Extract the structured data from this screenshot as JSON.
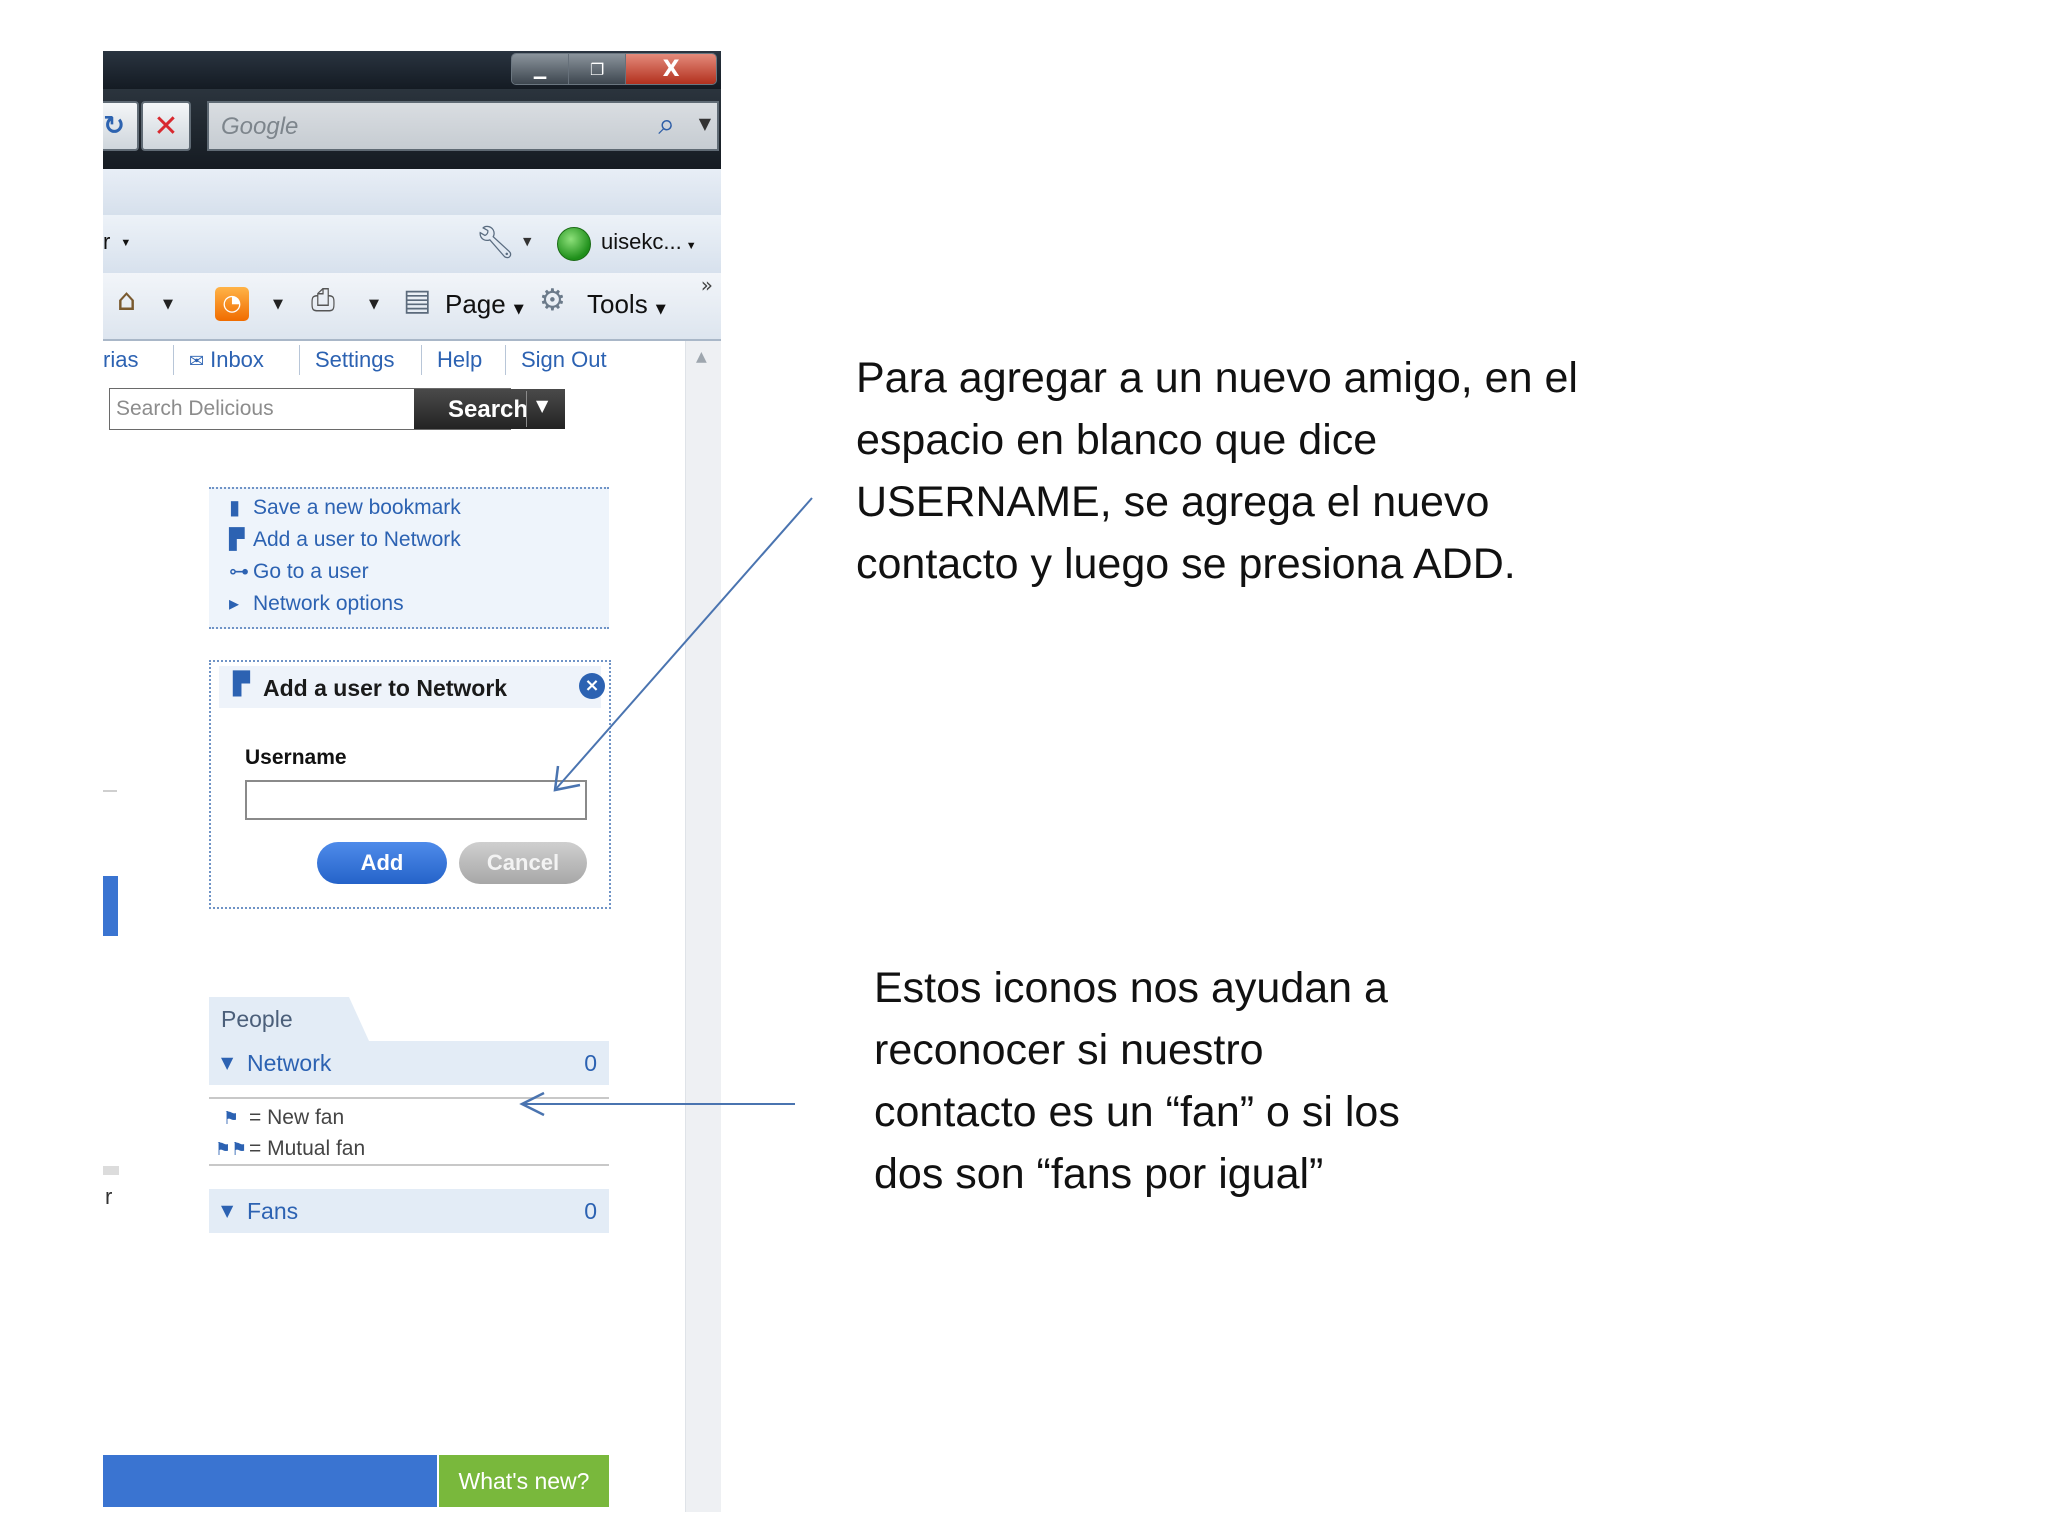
{
  "window": {
    "minimize_icon": "minimize-icon",
    "maximize_icon": "maximize-icon",
    "close_label": "X"
  },
  "navbar": {
    "refresh_icon": "refresh-icon",
    "stop_icon": "stop-icon",
    "search_placeholder": "Google"
  },
  "command_bar": {
    "partial_left": "r",
    "user_label": "uisekc...",
    "page_label": "Page",
    "tools_label": "Tools",
    "more_label": "»"
  },
  "delicious": {
    "top_nav": [
      "rias",
      "Inbox",
      "Settings",
      "Help",
      "Sign Out"
    ],
    "search_placeholder": "Search Delicious",
    "search_button": "Search",
    "menu": [
      {
        "icon": "bookmark-icon",
        "label": "Save a new bookmark"
      },
      {
        "icon": "add-user-icon",
        "label": "Add a user to Network"
      },
      {
        "icon": "binoculars-icon",
        "label": "Go to a user"
      },
      {
        "icon": "triangle-right-icon",
        "label": "Network options"
      }
    ],
    "add_panel": {
      "title": "Add a user to Network",
      "username_label": "Username",
      "username_value": "",
      "add_button": "Add",
      "cancel_button": "Cancel"
    },
    "people": {
      "tab_label": "People",
      "network_label": "Network",
      "network_count": "0",
      "legend": [
        {
          "icon": "single-flag-icon",
          "label": "= New fan"
        },
        {
          "icon": "double-flag-icon",
          "label": "= Mutual fan"
        }
      ],
      "fans_label": "Fans",
      "fans_count": "0"
    },
    "left_edge_char": "r",
    "whats_new": "What's new?"
  },
  "annotations": {
    "note1": "Para agregar a un nuevo amigo, en el espacio en blanco que dice USERNAME, se agrega el nuevo contacto y luego se presiona ADD.",
    "note2": "Estos iconos nos ayudan a reconocer si nuestro contacto es un “fan” o si los dos son “fans por igual”"
  },
  "colors": {
    "link_blue": "#2c62b2",
    "add_button": "#2563c9",
    "whats_new_green": "#79b83c",
    "arrow_blue": "#4a74b0"
  }
}
